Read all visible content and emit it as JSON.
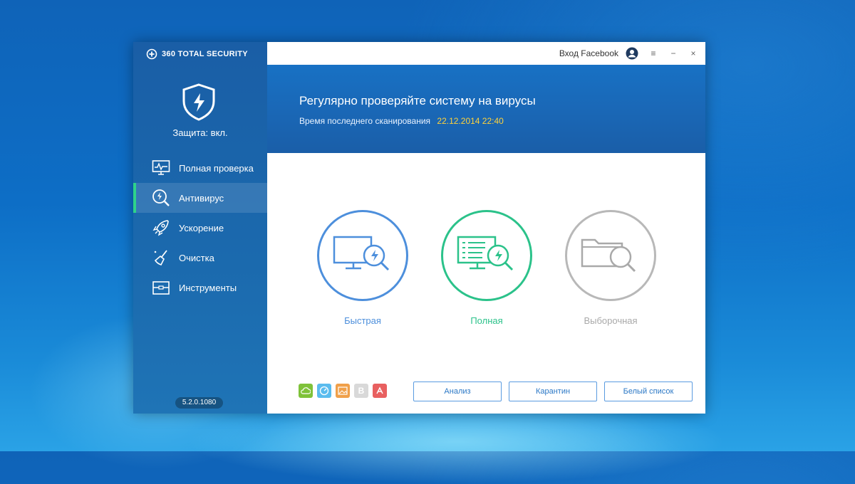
{
  "app": {
    "brand": "360 TOTAL SECURITY",
    "protection_status": "Защита: вкл.",
    "version": "5.2.0.1080"
  },
  "sidebar": {
    "items": [
      {
        "label": "Полная проверка",
        "icon": "monitor-pulse-icon",
        "active": false
      },
      {
        "label": "Антивирус",
        "icon": "magnifier-bolt-icon",
        "active": true
      },
      {
        "label": "Ускорение",
        "icon": "rocket-icon",
        "active": false
      },
      {
        "label": "Очистка",
        "icon": "broom-icon",
        "active": false
      },
      {
        "label": "Инструменты",
        "icon": "toolbox-icon",
        "active": false
      }
    ]
  },
  "titlebar": {
    "login_label": "Вход Facebook",
    "menu_glyph": "≡",
    "minimize_glyph": "−",
    "close_glyph": "×"
  },
  "hero": {
    "title": "Регулярно проверяйте систему на вирусы",
    "last_scan_label": "Время последнего сканирования",
    "last_scan_value": "22.12.2014 22:40"
  },
  "scans": [
    {
      "label": "Быстрая",
      "color": "#4d8fdc",
      "icon": "monitor-scan-icon"
    },
    {
      "label": "Полная",
      "color": "#2bc28a",
      "icon": "list-scan-icon"
    },
    {
      "label": "Выборочная",
      "color": "#a9a9a9",
      "icon": "folder-scan-icon"
    }
  ],
  "footer_buttons": {
    "analyze": "Анализ",
    "quarantine": "Карантин",
    "whitelist": "Белый список"
  },
  "footer_tools": [
    {
      "icon": "cloud-icon",
      "color": "#7fc23a"
    },
    {
      "icon": "gauge-icon",
      "color": "#5bbcee"
    },
    {
      "icon": "image-icon",
      "color": "#f0a04a"
    },
    {
      "icon": "b-engine-icon",
      "color": "#d9d9d9",
      "glyph": "B"
    },
    {
      "icon": "avira-icon",
      "color": "#e86060"
    }
  ],
  "colors": {
    "accent_green": "#2ed38a",
    "date_yellow": "#ffd23a"
  }
}
